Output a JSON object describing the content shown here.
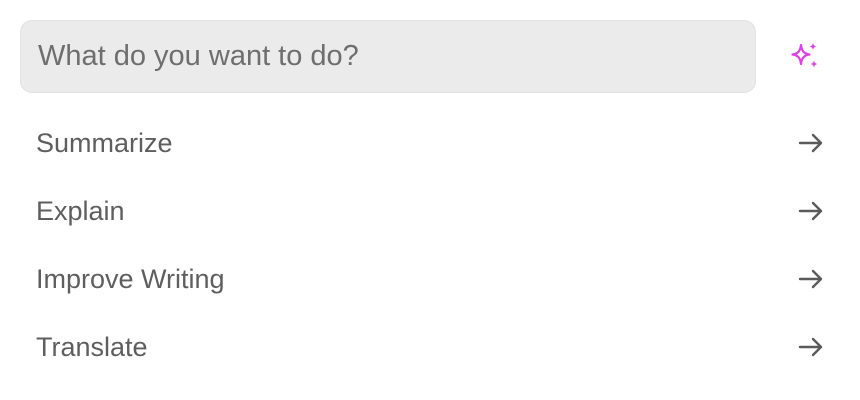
{
  "prompt": {
    "placeholder": "What do you want to do?",
    "value": "",
    "submit_icon": "sparkle-icon",
    "accent_color": "#e040e8"
  },
  "actions": [
    {
      "label": "Summarize",
      "icon": "arrow-right-icon"
    },
    {
      "label": "Explain",
      "icon": "arrow-right-icon"
    },
    {
      "label": "Improve Writing",
      "icon": "arrow-right-icon"
    },
    {
      "label": "Translate",
      "icon": "arrow-right-icon"
    }
  ],
  "colors": {
    "input_background": "#ebebeb",
    "text": "#5e5e5e",
    "arrow": "#5a5a5a"
  }
}
